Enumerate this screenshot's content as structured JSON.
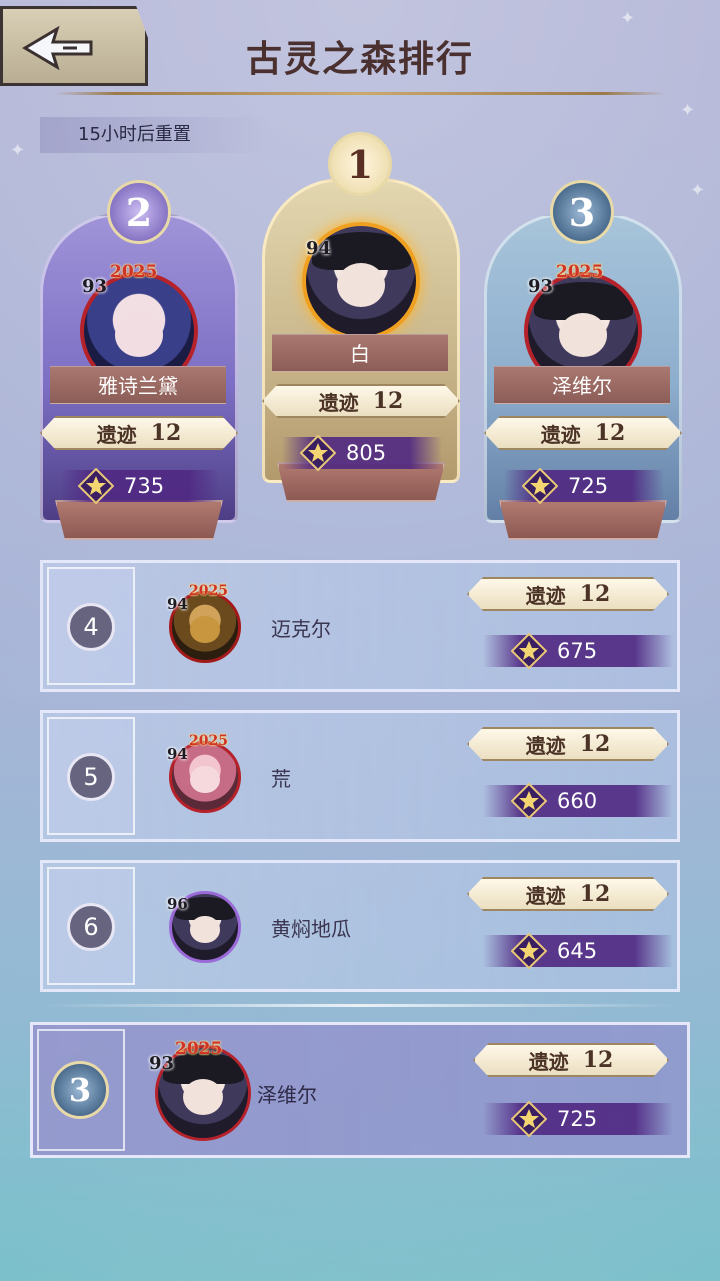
{
  "header": {
    "title": "古灵之森排行",
    "reset_text": "15小时后重置",
    "back_icon": "back-arrow-icon"
  },
  "podium": [
    {
      "rank": "2",
      "level": "93",
      "year": "2025",
      "name": "雅诗兰黛",
      "relic_label": "遗迹",
      "relic_value": "12",
      "score": "735"
    },
    {
      "rank": "1",
      "level": "94",
      "year": "",
      "name": "白",
      "relic_label": "遗迹",
      "relic_value": "12",
      "score": "805"
    },
    {
      "rank": "3",
      "level": "93",
      "year": "2025",
      "name": "泽维尔",
      "relic_label": "遗迹",
      "relic_value": "12",
      "score": "725"
    }
  ],
  "list": [
    {
      "rank": "4",
      "level": "94",
      "year": "2025",
      "name": "迈克尔",
      "relic_label": "遗迹",
      "relic_value": "12",
      "score": "675"
    },
    {
      "rank": "5",
      "level": "94",
      "year": "2025",
      "name": "荒",
      "relic_label": "遗迹",
      "relic_value": "12",
      "score": "660"
    },
    {
      "rank": "6",
      "level": "96",
      "year": "",
      "name": "黄焖地瓜",
      "relic_label": "遗迹",
      "relic_value": "12",
      "score": "645"
    }
  ],
  "self": {
    "rank": "3",
    "level": "93",
    "year": "2025",
    "name": "泽维尔",
    "relic_label": "遗迹",
    "relic_value": "12",
    "score": "725"
  },
  "colors": {
    "gold": "#e8d9a8",
    "name_banner": "#8c5d57",
    "score_bar": "#50288a",
    "first_glow": "#ffb32a"
  }
}
